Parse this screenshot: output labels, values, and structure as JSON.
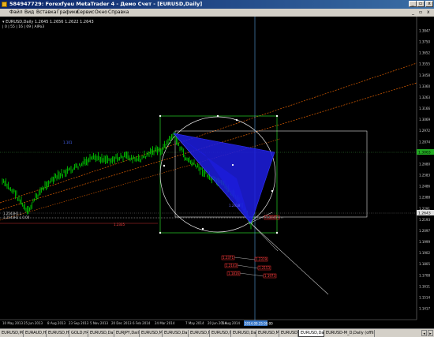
{
  "window": {
    "title": "584947729: Forexfyeu MetaTrader 4 - Демо Счет - [EURUSD,Daily]",
    "minimize": "_",
    "restore": "▫",
    "close": "x"
  },
  "menu": {
    "items": [
      {
        "label": "Файл"
      },
      {
        "label": "Вид"
      },
      {
        "label": "Вставка"
      },
      {
        "label": "Графики"
      },
      {
        "label": "Сервис"
      },
      {
        "label": "Окно"
      },
      {
        "label": "Справка"
      }
    ],
    "doc_minimize": "_",
    "doc_restore": "▫",
    "doc_close": "x"
  },
  "chart": {
    "header_line1": "▾ EURUSD,Daily 1.2645 1.2656 1.2622 1.2643",
    "header_line2": "| 0 | 55 | 16 | 09 | AIPo3",
    "symbol": "EURUSD",
    "timeframe": "Daily",
    "current_price": "1.2643",
    "price_axis_labels": [
      "1.3847",
      "1.3750",
      "1.3652",
      "1.3555",
      "1.3458",
      "1.3360",
      "1.3263",
      "1.3166",
      "1.3069",
      "1.2972",
      "1.2874",
      "1.2777",
      "1.2680",
      "1.2583",
      "1.2486",
      "1.2388",
      "1.2291",
      "1.2193",
      "1.2097",
      "1.1999",
      "1.1902",
      "1.1805",
      "1.1708",
      "1.1611",
      "1.1514",
      "1.1417"
    ],
    "price_marker_green": "1.3063",
    "price_marker_current": "1.2643",
    "time_axis_labels": [
      "10 May 2013",
      "25 Jun 2013",
      "8 Aug 2013",
      "23 Sep 2013",
      "5 Nov 2013",
      "20 Dec 2013",
      "6 Feb 2014",
      "24 Mar 2014",
      "7 May 2014",
      "20 Jun 2014",
      "5 Aug 2014"
    ],
    "time_marker": "2014.09.25 00:00",
    "line_labels": {
      "ltrend": "1.101",
      "left1": "1.2543H1 L",
      "left2": "1.2543H2 L 0.00",
      "bottom_red": "1.2335",
      "fib": "1.2418"
    },
    "red_labels_left": [
      "1.2371",
      "1.2143",
      "1.1816"
    ],
    "red_labels_right": [
      "1.2319",
      "1.2153",
      "1.1973"
    ],
    "red_label_side": "1.2645",
    "colors": {
      "background": "#000000",
      "candles": "#00c000",
      "harmonic_pattern": "#2222ee",
      "rectangle": "#22bb22",
      "circle": "#dcdcdc",
      "channel": "#e06000",
      "crosshair": "#5aa0e0"
    }
  },
  "tabs": [
    {
      "label": "EURUSD,M15"
    },
    {
      "label": "EURAUD,H4"
    },
    {
      "label": "EURUSD,H4"
    },
    {
      "label": "GOLD,H4"
    },
    {
      "label": "EURUSD,Daily"
    },
    {
      "label": "EURJPY,Daily"
    },
    {
      "label": "EURUSD,M5"
    },
    {
      "label": "EURUSD,Daily"
    },
    {
      "label": "EURUSD,H1"
    },
    {
      "label": "EURUSD,H1"
    },
    {
      "label": "EURUSD,Daily"
    },
    {
      "label": "EURUSD,M15"
    },
    {
      "label": "EURUSD,H1"
    },
    {
      "label": "EURUSD,Daily"
    },
    {
      "label": "EURUSD-M_D,Daily (offline)"
    }
  ],
  "tab_nav": {
    "prev": "◂",
    "next": "▸"
  }
}
